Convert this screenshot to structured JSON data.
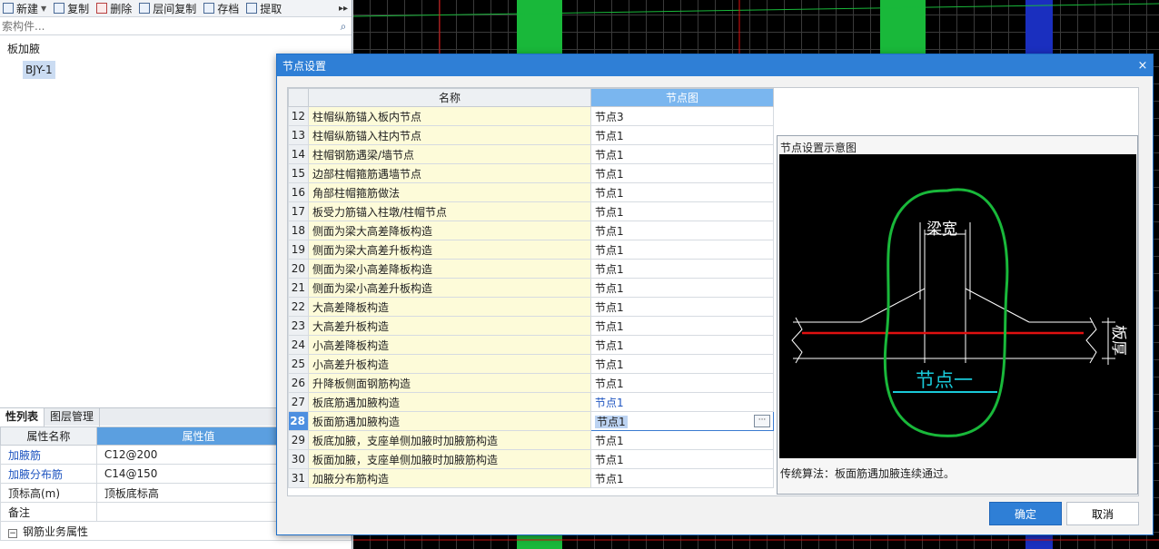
{
  "toolbar": {
    "new_label": "新建",
    "copy_label": "复制",
    "delete_label": "删除",
    "floor_copy_label": "层间复制",
    "save_label": "存档",
    "extract_label": "提取",
    "more_label": "▸▸"
  },
  "search": {
    "placeholder": "索构件..."
  },
  "tree": {
    "root": "板加腋",
    "child": "BJY-1"
  },
  "props": {
    "tabs": [
      "性列表",
      "图层管理"
    ],
    "header": [
      "属性名称",
      "属性值"
    ],
    "rows": [
      {
        "name": "加腋筋",
        "value": "C12@200"
      },
      {
        "name": "加腋分布筋",
        "value": "C14@150"
      },
      {
        "name": "顶标高(m)",
        "value": "顶板底标高"
      },
      {
        "name": "备注",
        "value": ""
      },
      {
        "name": "钢筋业务属性",
        "value": ""
      }
    ]
  },
  "dialog": {
    "title": "节点设置",
    "close": "×",
    "col_name": "名称",
    "col_node": "节点图",
    "rows": [
      {
        "no": "12",
        "name": "柱帽纵筋锚入板内节点",
        "node": "节点3"
      },
      {
        "no": "13",
        "name": "柱帽纵筋锚入柱内节点",
        "node": "节点1"
      },
      {
        "no": "14",
        "name": "柱帽钢筋遇梁/墙节点",
        "node": "节点1"
      },
      {
        "no": "15",
        "name": "边部柱帽箍筋遇墙节点",
        "node": "节点1"
      },
      {
        "no": "16",
        "name": "角部柱帽箍筋做法",
        "node": "节点1"
      },
      {
        "no": "17",
        "name": "板受力筋锚入柱墩/柱帽节点",
        "node": "节点1"
      },
      {
        "no": "18",
        "name": "侧面为梁大高差降板构造",
        "node": "节点1"
      },
      {
        "no": "19",
        "name": "侧面为梁大高差升板构造",
        "node": "节点1"
      },
      {
        "no": "20",
        "name": "侧面为梁小高差降板构造",
        "node": "节点1"
      },
      {
        "no": "21",
        "name": "侧面为梁小高差升板构造",
        "node": "节点1"
      },
      {
        "no": "22",
        "name": "大高差降板构造",
        "node": "节点1"
      },
      {
        "no": "23",
        "name": "大高差升板构造",
        "node": "节点1"
      },
      {
        "no": "24",
        "name": "小高差降板构造",
        "node": "节点1"
      },
      {
        "no": "25",
        "name": "小高差升板构造",
        "node": "节点1"
      },
      {
        "no": "26",
        "name": "升降板侧面钢筋构造",
        "node": "节点1"
      },
      {
        "no": "27",
        "name": "板底筋遇加腋构造",
        "node": "节点1"
      },
      {
        "no": "28",
        "name": "板面筋遇加腋构造",
        "node": "节点1"
      },
      {
        "no": "29",
        "name": "板底加腋，支座单侧加腋时加腋筋构造",
        "node": "节点1"
      },
      {
        "no": "30",
        "name": "板面加腋，支座单侧加腋时加腋筋构造",
        "node": "节点1"
      },
      {
        "no": "31",
        "name": "加腋分布筋构造",
        "node": "节点1"
      }
    ],
    "ellipsis": "···",
    "preview_label": "节点设置示意图",
    "diagram": {
      "beam_width": "梁宽",
      "slab_thick": "板厚",
      "node_name": "节点一"
    },
    "caption": "传统算法：板面筋遇加腋连续通过。",
    "ok": "确定",
    "cancel": "取消"
  },
  "colors": {
    "accent": "#2f7fd6",
    "highlight_green": "#19b83a",
    "rebar_red": "#e01010",
    "annotation_cyan": "#19c9d8"
  }
}
